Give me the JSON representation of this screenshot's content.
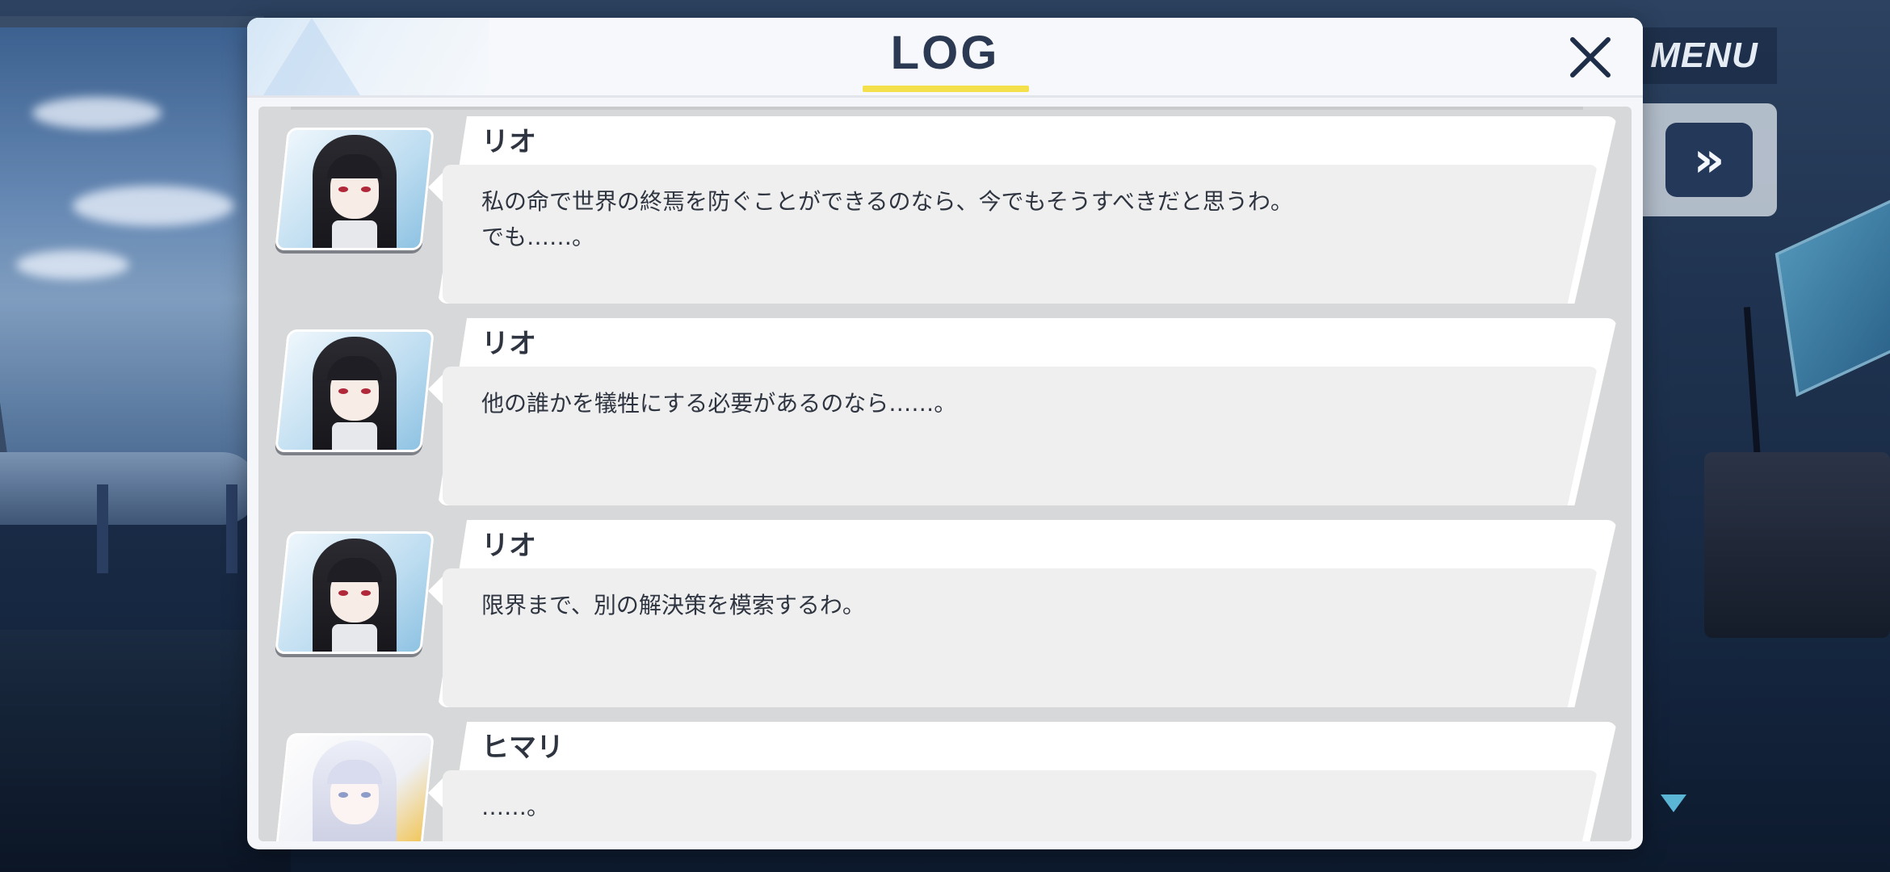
{
  "header": {
    "title": "LOG",
    "close_icon": "close-icon"
  },
  "hud": {
    "menu_label": "MENU",
    "fast_forward_icon": "fast-forward-icon",
    "fast_forward_glyph": "»",
    "scroll_icon": "scroll-down-icon"
  },
  "colors": {
    "title_underline": "#f3e04b",
    "title_text": "#2b3a52",
    "hud_button": "#24385a"
  },
  "log": {
    "entries": [
      {
        "speaker": "リオ",
        "portrait": "rio-portrait",
        "text": "私の命で世界の終焉を防ぐことができるのなら、今でもそうすべきだと思うわ。\nでも……。"
      },
      {
        "speaker": "リオ",
        "portrait": "rio-portrait",
        "text": "他の誰かを犠牲にする必要があるのなら……。"
      },
      {
        "speaker": "リオ",
        "portrait": "rio-portrait",
        "text": "限界まで、別の解決策を模索するわ。"
      },
      {
        "speaker": "ヒマリ",
        "portrait": "himari-portrait",
        "text": "……。"
      }
    ]
  }
}
